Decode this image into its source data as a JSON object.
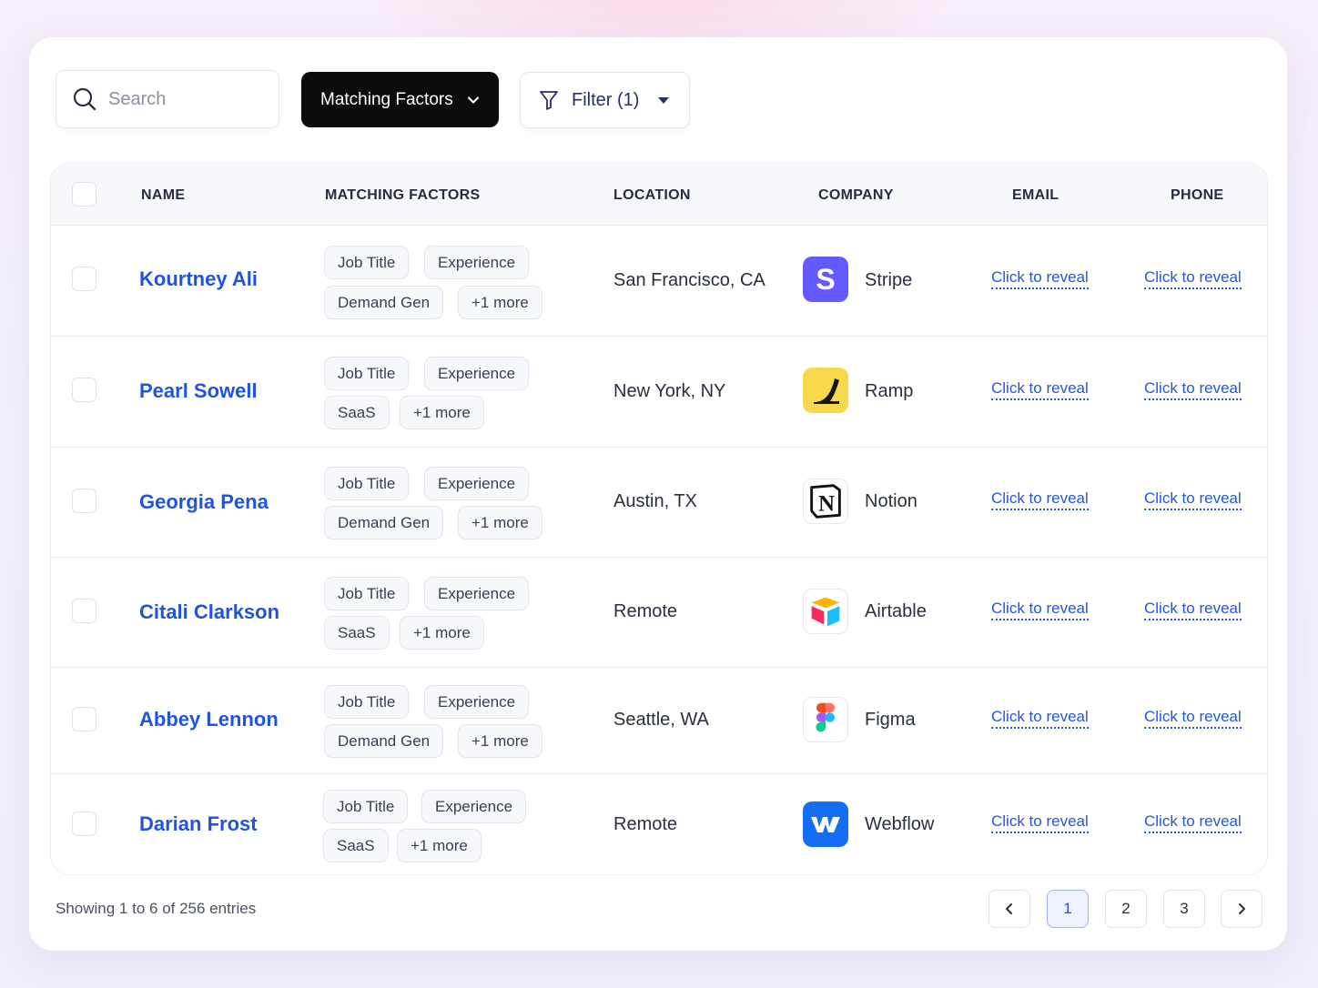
{
  "toolbar": {
    "search_placeholder": "Search",
    "matching_factors_label": "Matching Factors",
    "filter_label": "Filter (1)"
  },
  "table": {
    "headers": {
      "name": "NAME",
      "matching_factors": "MATCHING FACTORS",
      "location": "LOCATION",
      "company": "COMPANY",
      "email": "EMAIL",
      "phone": "PHONE"
    },
    "reveal_label": "Click to reveal",
    "rows": [
      {
        "name": "Kourtney Ali",
        "chips": [
          "Job Title",
          "Experience",
          "Demand Gen",
          "+1 more"
        ],
        "location": "San Francisco, CA",
        "company": "Stripe",
        "logo_icon": "stripe-logo-icon"
      },
      {
        "name": "Pearl Sowell",
        "chips": [
          "Job Title",
          "Experience",
          "SaaS",
          "+1 more"
        ],
        "location": "New York, NY",
        "company": "Ramp",
        "logo_icon": "ramp-logo-icon"
      },
      {
        "name": "Georgia Pena",
        "chips": [
          "Job Title",
          "Experience",
          "Demand Gen",
          "+1 more"
        ],
        "location": "Austin, TX",
        "company": "Notion",
        "logo_icon": "notion-logo-icon"
      },
      {
        "name": "Citali Clarkson",
        "chips": [
          "Job Title",
          "Experience",
          "SaaS",
          "+1 more"
        ],
        "location": "Remote",
        "company": "Airtable",
        "logo_icon": "airtable-logo-icon"
      },
      {
        "name": "Abbey Lennon",
        "chips": [
          "Job Title",
          "Experience",
          "Demand Gen",
          "+1 more"
        ],
        "location": "Seattle, WA",
        "company": "Figma",
        "logo_icon": "figma-logo-icon"
      },
      {
        "name": "Darian Frost",
        "chips": [
          "Job Title",
          "Experience",
          "SaaS",
          "+1 more"
        ],
        "location": "Remote",
        "company": "Webflow",
        "logo_icon": "webflow-logo-icon"
      }
    ]
  },
  "footer": {
    "showing_text": "Showing 1 to 6 of 256 entries",
    "pages": [
      "1",
      "2",
      "3"
    ],
    "active_page": "1"
  },
  "colors": {
    "accent_blue": "#1f54e3",
    "dark_button": "#0c0c0e",
    "stripe": "#635bff",
    "ramp": "#f7d94c",
    "webflow": "#146ef5"
  }
}
